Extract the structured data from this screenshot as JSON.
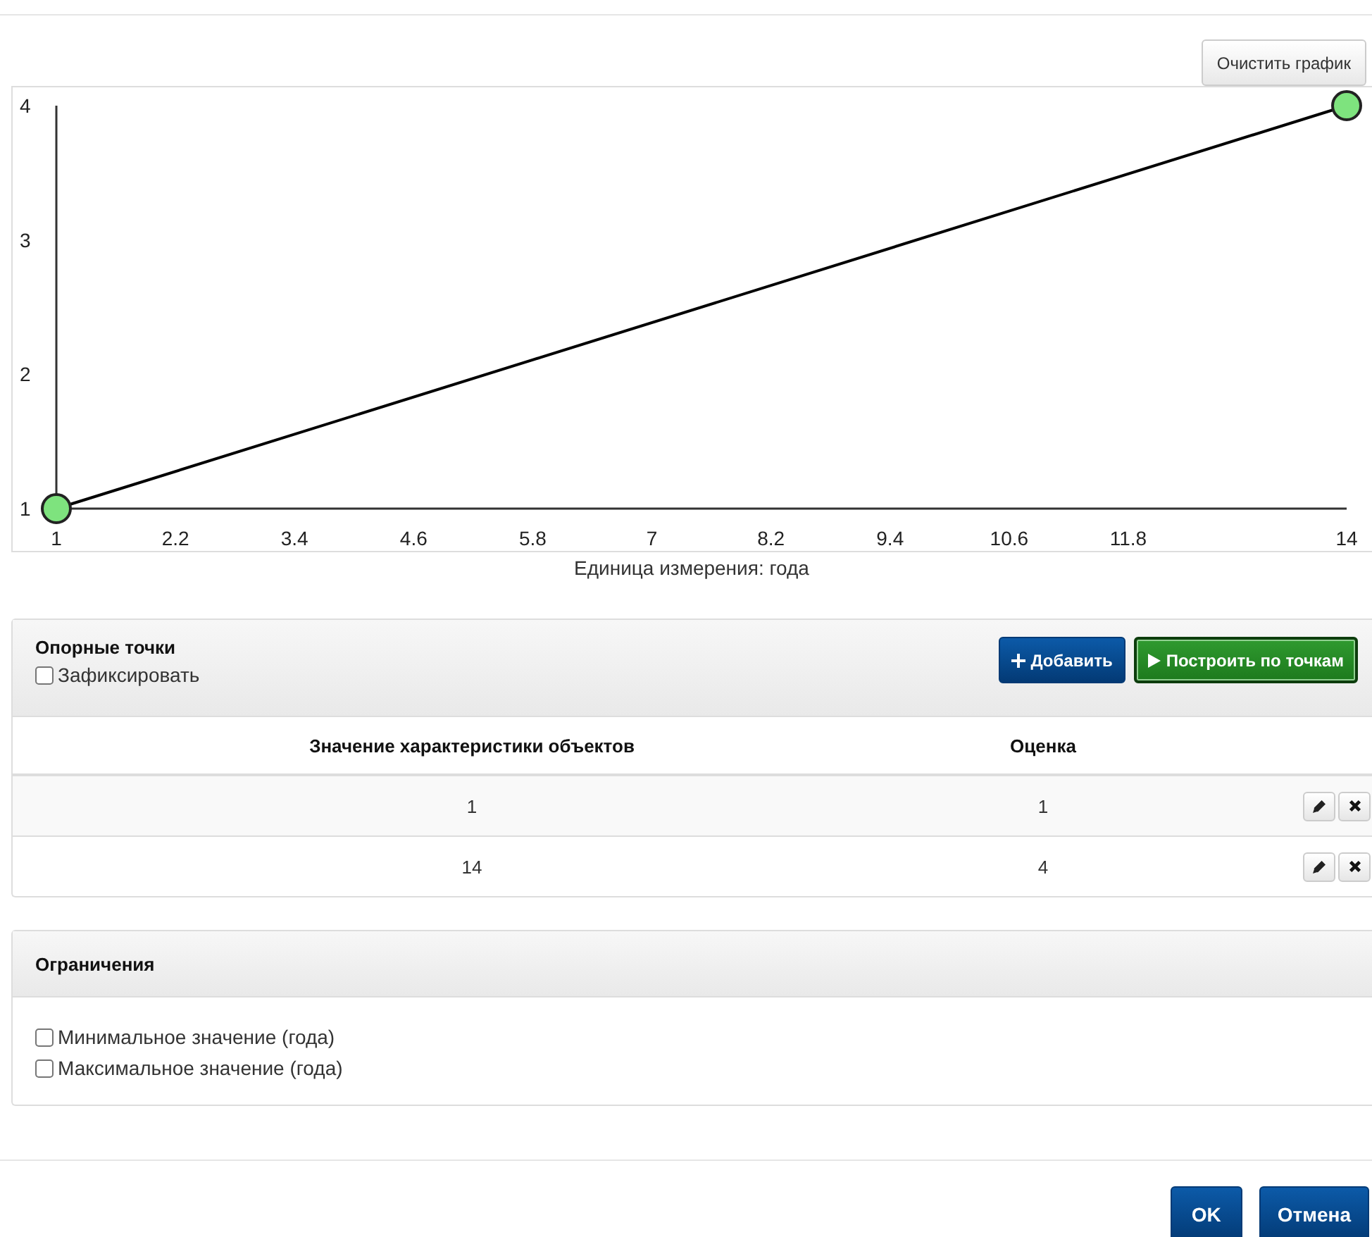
{
  "clear_button": "Очистить график",
  "chart": {
    "chart_data": {
      "type": "line",
      "x": [
        1,
        14
      ],
      "series": [
        {
          "color": "#000000",
          "marker": "circle",
          "values": [
            1,
            4
          ]
        }
      ],
      "xlim": [
        1,
        14
      ],
      "ylim": [
        1,
        4
      ],
      "xticks": [
        1,
        2.2,
        3.4,
        4.6,
        5.8,
        7,
        8.2,
        9.4,
        10.6,
        11.8,
        14
      ],
      "yticks": [
        1,
        2,
        3,
        4
      ],
      "xlabel": "Единица измерения: года"
    }
  },
  "points_panel": {
    "title": "Опорные точки",
    "fix": {
      "label": "Зафиксировать",
      "checked": false
    },
    "buttons": [
      {
        "kind": "add",
        "label": "Добавить"
      },
      {
        "kind": "build",
        "label": "Построить по точкам"
      }
    ],
    "columns": [
      "Значение характеристики объектов",
      "Оценка"
    ],
    "rows": [
      [
        "1",
        "1"
      ],
      [
        "14",
        "4"
      ]
    ]
  },
  "limits_panel": {
    "title": "Ограничения",
    "options": [
      {
        "label": "Минимальное значение (года)",
        "checked": false
      },
      {
        "label": "Максимальное значение (года)",
        "checked": false
      }
    ]
  },
  "footer_buttons": [
    "OK",
    "Отмена"
  ]
}
